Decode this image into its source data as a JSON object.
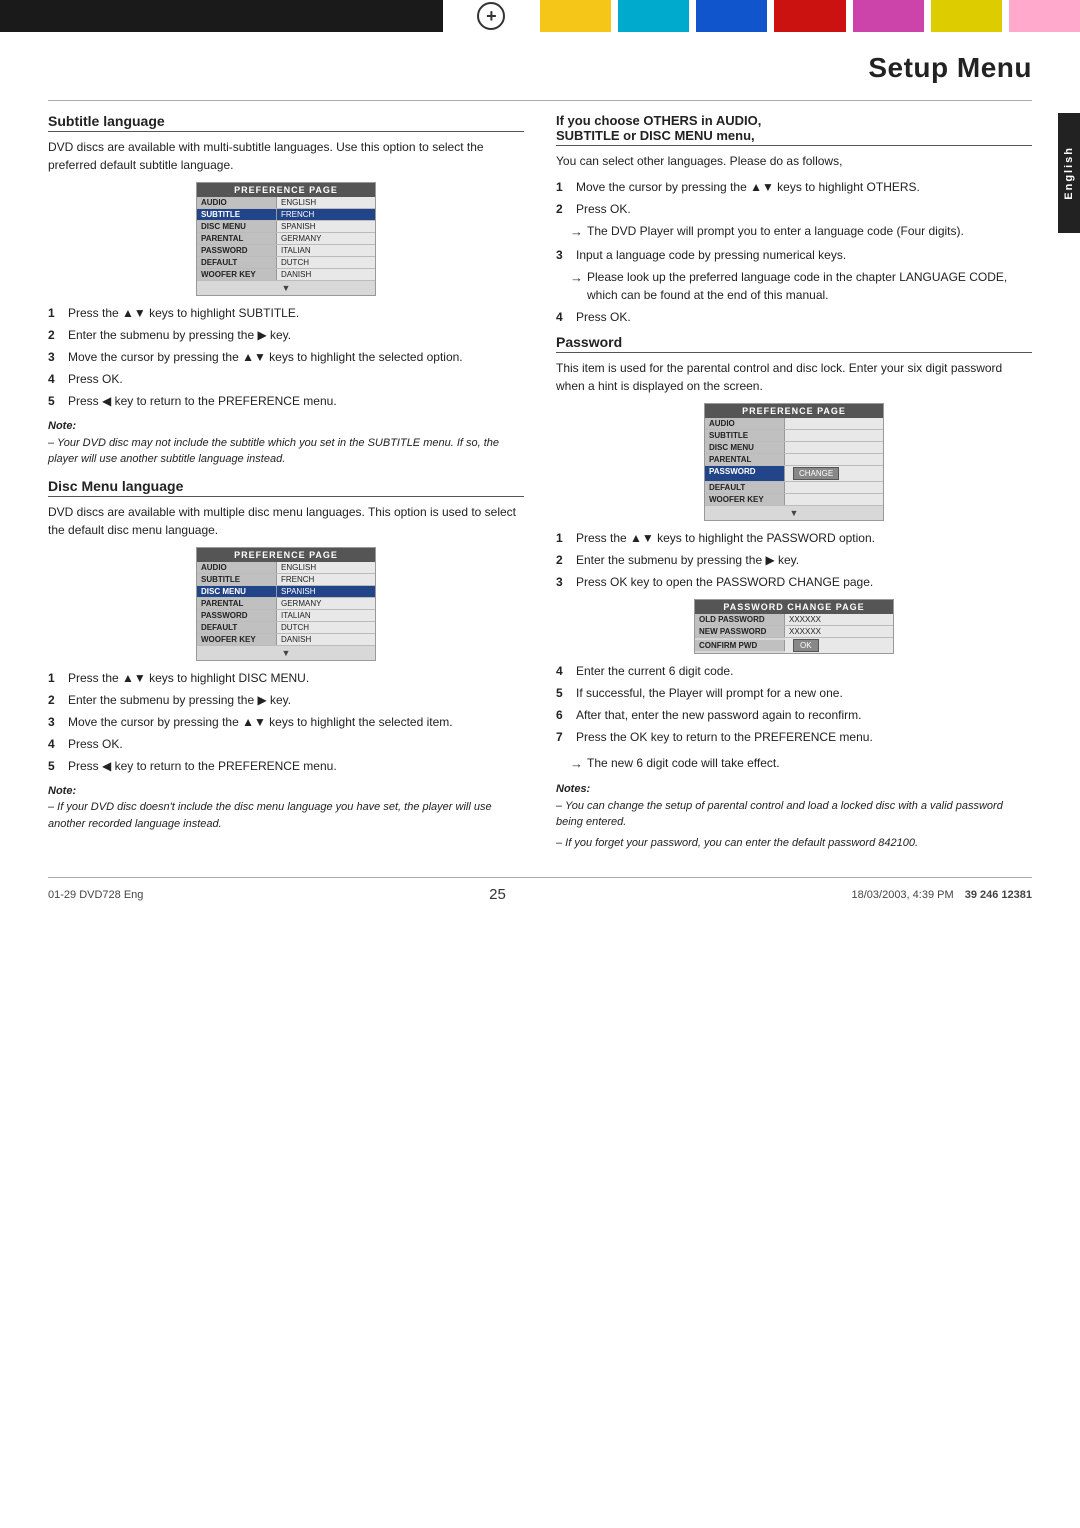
{
  "page": {
    "title": "Setup Menu",
    "page_number": "25",
    "bottom_left": "01-29 DVD728 Eng",
    "bottom_center": "25",
    "bottom_right": "18/03/2003, 4:39 PM",
    "barcode": "39 246 12381"
  },
  "english_tab": "English",
  "left_column": {
    "subtitle_language": {
      "heading": "Subtitle language",
      "description": "DVD discs are available with multi-subtitle languages. Use this option to select the preferred default subtitle language.",
      "pref_pane_title": "PREFERENCE PAGE",
      "pref_rows": [
        {
          "label": "AUDIO",
          "value": "ENGLISH",
          "active": false
        },
        {
          "label": "SUBTITLE",
          "value": "FRENCH",
          "active": true
        },
        {
          "label": "DISC MENU",
          "value": "SPANISH",
          "active": false
        },
        {
          "label": "PARENTAL",
          "value": "GERMANY",
          "active": false
        },
        {
          "label": "PASSWORD",
          "value": "ITALIAN",
          "active": false
        },
        {
          "label": "DEFAULT",
          "value": "DUTCH",
          "active": false
        },
        {
          "label": "WOOFER KEY",
          "value": "DANISH",
          "active": false
        }
      ],
      "steps": [
        "Press the ▲▼ keys to highlight SUBTITLE.",
        "Enter the submenu by pressing the ▶ key.",
        "Move the cursor by pressing the ▲▼ keys to highlight the selected option.",
        "Press OK.",
        "Press ◀ key to return to the PREFERENCE menu."
      ],
      "note_title": "Note:",
      "note_text": "– Your DVD disc may not include the subtitle which you set in the SUBTITLE menu. If so, the player will use another subtitle language instead."
    },
    "disc_menu_language": {
      "heading": "Disc Menu language",
      "description": "DVD discs are available with multiple disc menu languages. This option is used to select the default disc menu language.",
      "pref_pane_title": "PREFERENCE PAGE",
      "pref_rows": [
        {
          "label": "AUDIO",
          "value": "ENGLISH",
          "active": false
        },
        {
          "label": "SUBTITLE",
          "value": "FRENCH",
          "active": false
        },
        {
          "label": "DISC MENU",
          "value": "SPANISH",
          "active": true
        },
        {
          "label": "PARENTAL",
          "value": "GERMANY",
          "active": false
        },
        {
          "label": "PASSWORD",
          "value": "ITALIAN",
          "active": false
        },
        {
          "label": "DEFAULT",
          "value": "DUTCH",
          "active": false
        },
        {
          "label": "WOOFER KEY",
          "value": "DANISH",
          "active": false
        }
      ],
      "steps": [
        "Press the ▲▼ keys to highlight DISC MENU.",
        "Enter the submenu by pressing the ▶ key.",
        "Move the cursor by pressing the ▲▼ keys to highlight the selected item.",
        "Press OK.",
        "Press ◀ key to return to the PREFERENCE menu."
      ],
      "note_title": "Note:",
      "note_text": "– If your DVD disc doesn't include the disc menu language you have set, the player will use another recorded language instead."
    }
  },
  "right_column": {
    "others_section": {
      "heading": "If you choose OTHERS in AUDIO, SUBTITLE or DISC MENU menu,",
      "description": "You can select other languages. Please do as follows,",
      "steps": [
        {
          "num": "1",
          "text": "Move the cursor by pressing the ▲▼ keys to highlight OTHERS."
        },
        {
          "num": "2",
          "text": "Press OK."
        },
        {
          "num": "3",
          "text": "Input a language code by pressing numerical keys."
        },
        {
          "num": "4",
          "text": "Press OK."
        }
      ],
      "arrow_notes": [
        "The DVD Player will prompt you to enter a language code (Four digits).",
        "Please look up the preferred language code in the chapter LANGUAGE CODE, which can be found at the end of this manual."
      ]
    },
    "password": {
      "heading": "Password",
      "description": "This item is used for the parental control and disc lock. Enter your six digit password when a hint is displayed on the screen.",
      "pref_pane_title": "PREFERENCE PAGE",
      "pref_rows": [
        {
          "label": "AUDIO",
          "value": ""
        },
        {
          "label": "SUBTITLE",
          "value": ""
        },
        {
          "label": "DISC MENU",
          "value": ""
        },
        {
          "label": "PARENTAL",
          "value": ""
        },
        {
          "label": "PASSWORD",
          "value": "CHANGE",
          "has_btn": true
        },
        {
          "label": "DEFAULT",
          "value": ""
        },
        {
          "label": "WOOFER KEY",
          "value": ""
        }
      ],
      "steps": [
        {
          "num": "1",
          "text": "Press the ▲▼ keys to highlight the PASSWORD option."
        },
        {
          "num": "2",
          "text": "Enter the submenu by pressing the ▶  key."
        },
        {
          "num": "3",
          "text": "Press OK key to open the PASSWORD CHANGE page."
        }
      ],
      "pwd_change_title": "PASSWORD CHANGE PAGE",
      "pwd_change_rows": [
        {
          "label": "OLD PASSWORD",
          "value": "XXXXXX"
        },
        {
          "label": "NEW PASSWORD",
          "value": "XXXXXX"
        },
        {
          "label": "CONFIRM PWD",
          "value": "OK",
          "is_ok": true
        }
      ],
      "steps2": [
        {
          "num": "4",
          "text": "Enter the current 6 digit code."
        },
        {
          "num": "5",
          "text": "If successful, the Player will prompt for a new one."
        },
        {
          "num": "6",
          "text": "After that, enter the new password again to reconfirm."
        },
        {
          "num": "7",
          "text": "Press the OK key to return to the PREFERENCE menu."
        }
      ],
      "arrow_note2": "The new 6 digit code will take effect.",
      "notes_title": "Notes:",
      "notes": [
        "– You can change the setup of parental control and load a locked disc with a valid password being entered.",
        "– If you forget your password, you can enter the default password 842100."
      ]
    }
  }
}
